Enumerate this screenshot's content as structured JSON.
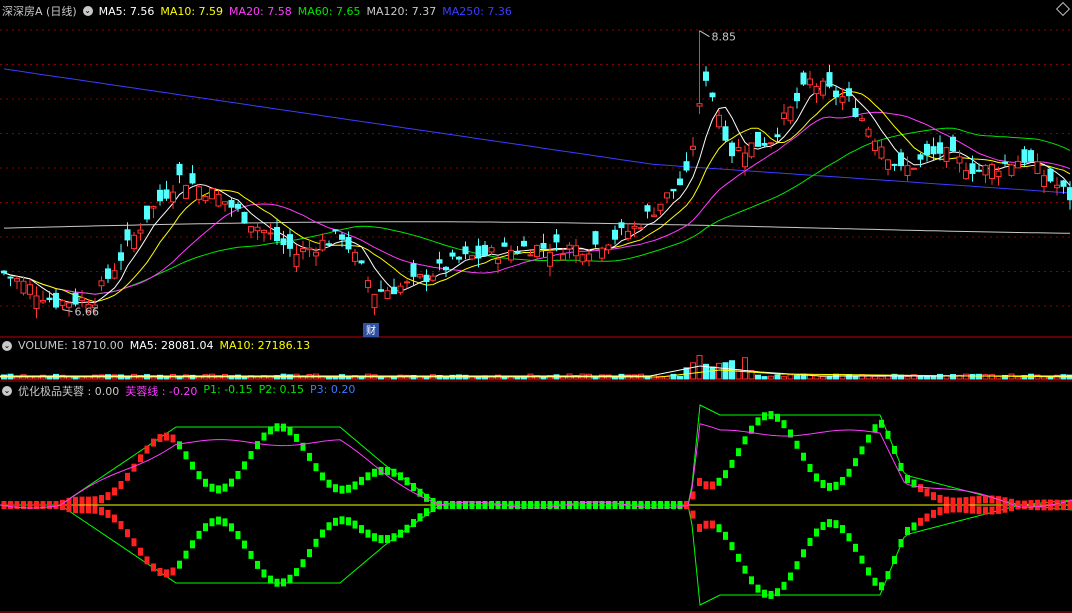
{
  "main_panel": {
    "title": "深深房A (日线)",
    "indicators": [
      {
        "label": "MA5: 7.56",
        "color": "#ffffff"
      },
      {
        "label": "MA10: 7.59",
        "color": "#ffff00"
      },
      {
        "label": "MA20: 7.58",
        "color": "#ff3cff"
      },
      {
        "label": "MA60: 7.65",
        "color": "#00e600"
      },
      {
        "label": "MA120: 7.37",
        "color": "#c8c8c8"
      },
      {
        "label": "MA250: 7.36",
        "color": "#3c3cff"
      }
    ],
    "high_label": "8.85",
    "low_label": "6.66",
    "finance_marker": "财"
  },
  "volume_panel": {
    "title": "VOLUME: 18710.00",
    "indicators": [
      {
        "label": "MA5: 28081.04",
        "color": "#ffffff"
      },
      {
        "label": "MA10: 27186.13",
        "color": "#ffff00"
      }
    ]
  },
  "indicator_panel": {
    "title": "优化极品芙蓉 : 0.00",
    "indicators": [
      {
        "label": "芙蓉线 : -0.20",
        "color": "#ff3cff"
      },
      {
        "label": "P1: -0.15",
        "color": "#00e600"
      },
      {
        "label": "P2: 0.15",
        "color": "#00e600"
      },
      {
        "label": "P3: 0.20",
        "color": "#3c7cff"
      }
    ]
  },
  "colors": {
    "up": "#ff3232",
    "down": "#54ffff",
    "grid": "#8b0000",
    "ma5": "#ffffff",
    "ma10": "#ffff00",
    "ma20": "#ff3cff",
    "ma60": "#00e600",
    "ma120": "#c8c8c8",
    "ma250": "#3c3cff",
    "osc_up": "#ff2020",
    "osc_down": "#00ff00"
  }
}
